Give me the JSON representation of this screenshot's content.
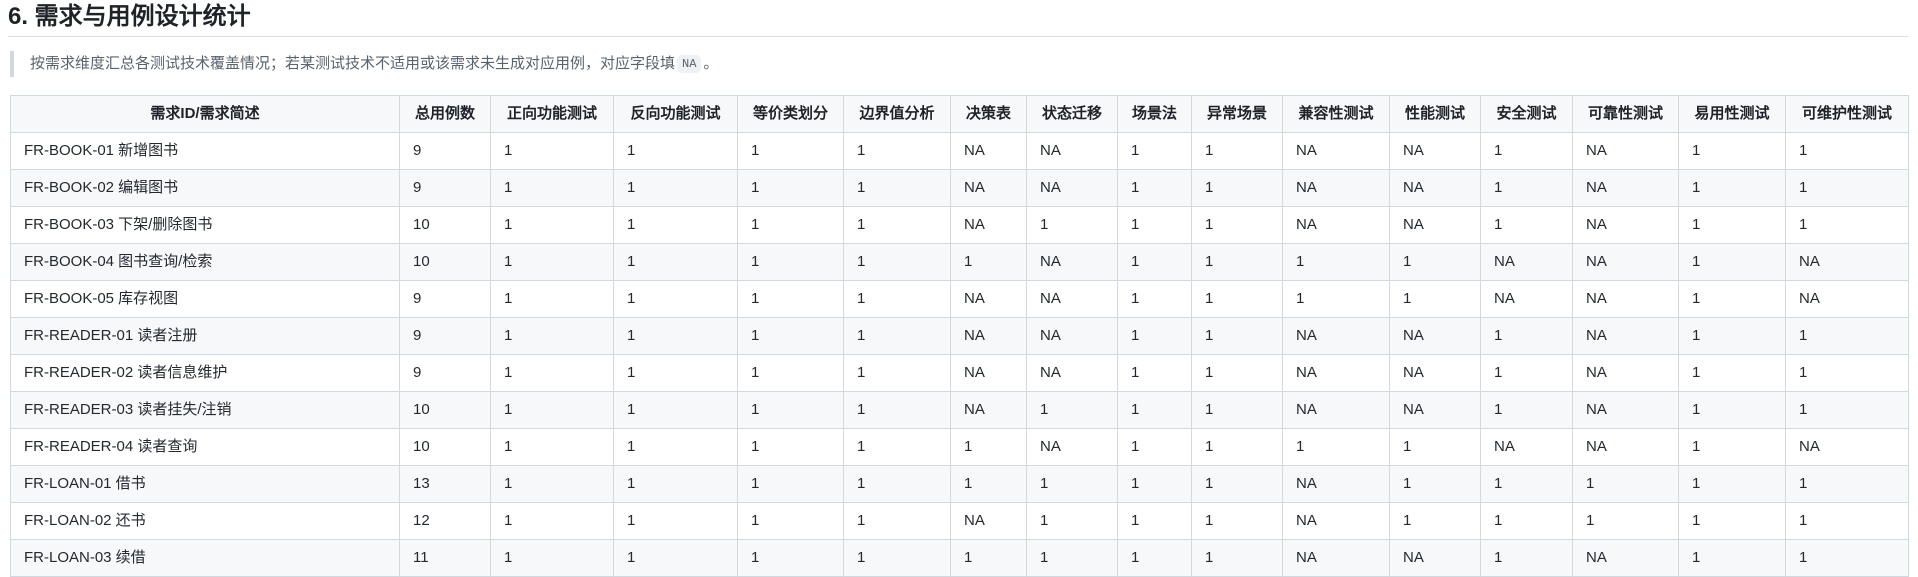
{
  "section": {
    "title": "6. 需求与用例设计统计"
  },
  "note": {
    "text_before": "按需求维度汇总各测试技术覆盖情况；若某测试技术不适用或该需求未生成对应用例，对应字段填",
    "code": "NA",
    "text_after": "。"
  },
  "table": {
    "headers": [
      "需求ID/需求简述",
      "总用例数",
      "正向功能测试",
      "反向功能测试",
      "等价类划分",
      "边界值分析",
      "决策表",
      "状态迁移",
      "场景法",
      "异常场景",
      "兼容性测试",
      "性能测试",
      "安全测试",
      "可靠性测试",
      "易用性测试",
      "可维护性测试"
    ],
    "rows": [
      [
        "FR-BOOK-01 新增图书",
        "9",
        "1",
        "1",
        "1",
        "1",
        "NA",
        "NA",
        "1",
        "1",
        "NA",
        "NA",
        "1",
        "NA",
        "1",
        "1"
      ],
      [
        "FR-BOOK-02 编辑图书",
        "9",
        "1",
        "1",
        "1",
        "1",
        "NA",
        "NA",
        "1",
        "1",
        "NA",
        "NA",
        "1",
        "NA",
        "1",
        "1"
      ],
      [
        "FR-BOOK-03 下架/删除图书",
        "10",
        "1",
        "1",
        "1",
        "1",
        "NA",
        "1",
        "1",
        "1",
        "NA",
        "NA",
        "1",
        "NA",
        "1",
        "1"
      ],
      [
        "FR-BOOK-04 图书查询/检索",
        "10",
        "1",
        "1",
        "1",
        "1",
        "1",
        "NA",
        "1",
        "1",
        "1",
        "1",
        "NA",
        "NA",
        "1",
        "NA"
      ],
      [
        "FR-BOOK-05 库存视图",
        "9",
        "1",
        "1",
        "1",
        "1",
        "NA",
        "NA",
        "1",
        "1",
        "1",
        "1",
        "NA",
        "NA",
        "1",
        "NA"
      ],
      [
        "FR-READER-01 读者注册",
        "9",
        "1",
        "1",
        "1",
        "1",
        "NA",
        "NA",
        "1",
        "1",
        "NA",
        "NA",
        "1",
        "NA",
        "1",
        "1"
      ],
      [
        "FR-READER-02 读者信息维护",
        "9",
        "1",
        "1",
        "1",
        "1",
        "NA",
        "NA",
        "1",
        "1",
        "NA",
        "NA",
        "1",
        "NA",
        "1",
        "1"
      ],
      [
        "FR-READER-03 读者挂失/注销",
        "10",
        "1",
        "1",
        "1",
        "1",
        "NA",
        "1",
        "1",
        "1",
        "NA",
        "NA",
        "1",
        "NA",
        "1",
        "1"
      ],
      [
        "FR-READER-04 读者查询",
        "10",
        "1",
        "1",
        "1",
        "1",
        "1",
        "NA",
        "1",
        "1",
        "1",
        "1",
        "NA",
        "NA",
        "1",
        "NA"
      ],
      [
        "FR-LOAN-01 借书",
        "13",
        "1",
        "1",
        "1",
        "1",
        "1",
        "1",
        "1",
        "1",
        "NA",
        "1",
        "1",
        "1",
        "1",
        "1"
      ],
      [
        "FR-LOAN-02 还书",
        "12",
        "1",
        "1",
        "1",
        "1",
        "NA",
        "1",
        "1",
        "1",
        "NA",
        "1",
        "1",
        "1",
        "1",
        "1"
      ],
      [
        "FR-LOAN-03 续借",
        "11",
        "1",
        "1",
        "1",
        "1",
        "1",
        "1",
        "1",
        "1",
        "NA",
        "NA",
        "1",
        "NA",
        "1",
        "1"
      ]
    ]
  }
}
